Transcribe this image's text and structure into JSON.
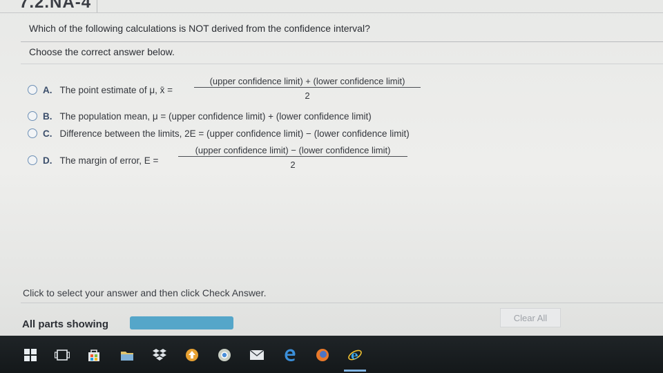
{
  "header": {
    "tab_text": "7.2.NA-4"
  },
  "question": "Which of the following calculations is NOT derived from the confidence interval?",
  "instruction": "Choose the correct answer below.",
  "options": [
    {
      "letter": "A.",
      "text": "The point estimate of μ, x̄ =",
      "numerator": "(upper confidence limit) + (lower confidence limit)",
      "denominator": "2",
      "selected": false
    },
    {
      "letter": "B.",
      "text": "The population mean, μ = (upper confidence limit) + (lower confidence limit)",
      "selected": false
    },
    {
      "letter": "C.",
      "text": "Difference between the limits, 2E = (upper confidence limit) − (lower confidence limit)",
      "selected": false
    },
    {
      "letter": "D.",
      "text": "The margin of error, E =",
      "numerator": "(upper confidence limit) − (lower confidence limit)",
      "denominator": "2",
      "selected": false
    }
  ],
  "footer": {
    "message": "Click to select your answer and then click Check Answer.",
    "status_label": "All parts showing",
    "progress_fraction": 1.0,
    "clear_all": "Clear All"
  },
  "taskbar": {
    "icons": [
      "windows-start-icon",
      "task-view-icon",
      "store-icon",
      "file-explorer-icon",
      "dropbox-icon",
      "upload-icon",
      "chrome-icon",
      "mail-icon",
      "edge-icon",
      "firefox-icon",
      "internet-explorer-icon"
    ]
  },
  "colors": {
    "accent": "#55a6c9",
    "radio": "#6c8fb5",
    "taskbar": "#1a1f22"
  }
}
